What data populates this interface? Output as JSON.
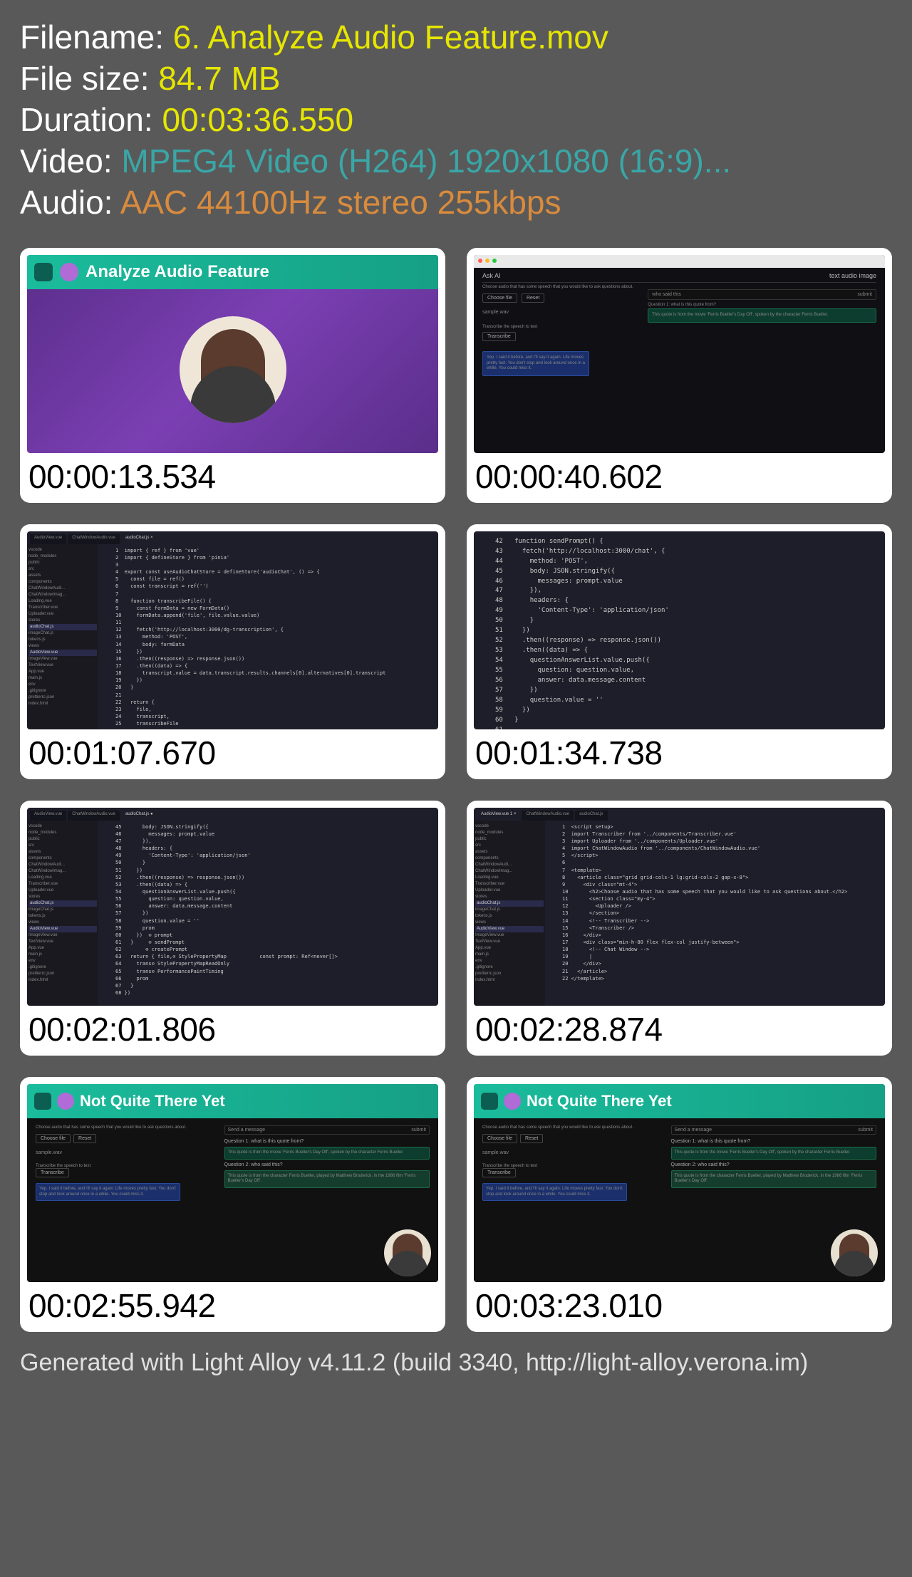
{
  "meta": {
    "filename_label": "Filename: ",
    "filename_value": "6. Analyze Audio Feature.mov",
    "filesize_label": "File size: ",
    "filesize_value": "84.7 MB",
    "duration_label": "Duration: ",
    "duration_value": "00:03:36.550",
    "video_label": "Video: ",
    "video_value": "MPEG4 Video (H264) 1920x1080 (16:9)...",
    "audio_label": "Audio: ",
    "audio_value": "AAC 44100Hz stereo 255kbps"
  },
  "timestamps": [
    "00:00:13.534",
    "00:00:40.602",
    "00:01:07.670",
    "00:01:34.738",
    "00:02:01.806",
    "00:02:28.874",
    "00:02:55.942",
    "00:03:23.010"
  ],
  "thumb1": {
    "title": "Analyze Audio Feature"
  },
  "thumb2": {
    "app_title": "Ask AI",
    "tabs": "text  audio  image",
    "instruction": "Choose audio that has some speech that you would like to ask questions about.",
    "choose": "Choose file",
    "reset": "Reset",
    "file": "sample.wav",
    "input_hint": "who said this",
    "submit": "submit",
    "q1": "Question 1: what is this quote from?",
    "a1": "This quote is from the movie 'Ferris Bueller's Day Off', spoken by the character Ferris Bueller.",
    "trans_label": "Transcribe the speech to text",
    "trans_btn": "Transcribe",
    "trans_text": "Yep. I said it before, and I'll say it again. Life moves pretty fast. You don't stop and look around once in a while. You could miss it."
  },
  "thumb3": {
    "tabs": [
      "AudioView.vue",
      "ChatWindowAudio.vue",
      "audioChat.js ×"
    ],
    "sidebar": [
      "vscode",
      "node_modules",
      "public",
      "src",
      " assets",
      " components",
      "  ChatWindowAudi...",
      "  ChatWindowImag...",
      "  Loading.vue",
      "  Transcriber.vue",
      "  Uploader.vue",
      " stores",
      "  audioChat.js",
      "  imageChat.js",
      "  tokens.js",
      " views",
      "  AudioView.vue",
      "  ImageView.vue",
      "  TextView.vue",
      " App.vue",
      " main.js",
      "env",
      ".gitignore",
      "prettierrc.json",
      "index.html"
    ],
    "code": "1  import { ref } from 'vue'\n2  import { defineStore } from 'pinia'\n3\n4  export const useAudioChatStore = defineStore('audioChat', () => {\n5    const file = ref()\n6    const transcript = ref('')\n7\n8    function transcribeFile() {\n9      const formData = new FormData()\n10     formData.append('file', file.value.value)\n11\n12     fetch('http://localhost:3000/dg-transcription', {\n13       method: 'POST',\n14       body: formData\n15     })\n16     .then((response) => response.json())\n17     .then((data) => {\n18       transcript.value = data.transcript.results.channels[0].alternatives[0].transcript\n19     })\n20   }\n21\n22   return {\n23     file,\n24     transcript,\n25     transcribeFile"
  },
  "thumb4": {
    "code": "42   function sendPrompt() {\n43     fetch('http://localhost:3000/chat', {\n44       method: 'POST',\n45       body: JSON.stringify({\n46         messages: prompt.value\n47       }),\n48       headers: {\n49         'Content-Type': 'application/json'\n50       }\n51     })\n52     .then((response) => response.json())\n53     .then((data) => {\n54       questionAnswerList.value.push({\n55         question: question.value,\n56         answer: data.message.content\n57       })\n58       question.value = ''\n59     })\n60   }\n61"
  },
  "thumb5": {
    "tabs": [
      "AudioView.vue",
      "ChatWindowAudio.vue",
      "audioChat.js ●"
    ],
    "sidebar": [
      "vscode",
      "node_modules",
      "public",
      "src",
      " assets",
      " components",
      "  ChatWindowAudi...",
      "  ChatWindowImag...",
      "  Loading.vue",
      "  Transcriber.vue",
      "  Uploader.vue",
      " stores",
      "  audioChat.js",
      "  imageChat.js",
      "  tokens.js",
      " views",
      "  AudioView.vue",
      "  ImageView.vue",
      "  TextView.vue",
      " App.vue",
      " main.js",
      "env",
      ".gitignore",
      "prettierrc.json",
      "index.html"
    ],
    "code": "45       body: JSON.stringify({\n46         messages: prompt.value\n47       }),\n48       headers: {\n49         'Content-Type': 'application/json'\n50       }\n51     })\n52     .then((response) => response.json())\n53     .then((data) => {\n54       questionAnswerList.value.push({\n55         question: question.value,\n56         answer: data.message.content\n57       })\n58       question.value = ''\n59       prom\n60     })  ⊙ prompt\n61   }     ⊙ sendPrompt\n62        ⊙ createPrompt\n63   return { file,⊙ StylePropertyMap           const prompt: Ref<never[]>\n64     trans⊙ StylePropertyMapReadOnly\n65     trans⊙ PerformancePaintTiming\n66     prom\n67   }\n68 })"
  },
  "thumb6": {
    "tabs": [
      "AudioView.vue 1 ×",
      "ChatWindowAudio.vue",
      "audioChat.js"
    ],
    "sidebar": [
      "vscode",
      "node_modules",
      "public",
      "src",
      " assets",
      " components",
      "  ChatWindowAudi...",
      "  ChatWindowImag...",
      "  Loading.vue",
      "  Transcriber.vue",
      "  Uploader.vue",
      " stores",
      "  audioChat.js",
      "  imageChat.js",
      "  tokens.js",
      " views",
      "  AudioView.vue",
      "  ImageView.vue",
      "  TextView.vue",
      " App.vue",
      " main.js",
      "env",
      ".gitignore",
      "prettierrc.json",
      "index.html"
    ],
    "code": "1  <script setup>\n2  import Transcriber from '../components/Transcriber.vue'\n3  import Uploader from '../components/Uploader.vue'\n4  import ChatWindowAudio from '../components/ChatWindowAudio.vue'\n5  </script>\n6\n7  <template>\n8    <article class=\"grid grid-cols-1 lg:grid-cols-2 gap-x-8\">\n9      <div class=\"mt-4\">\n10       <h2>Choose audio that has some speech that you would like to ask questions about.</h2>\n11       <section class=\"my-4\">\n12         <Uploader />\n13       </section>\n14       <!-- Transcriber -->\n15       <Transcriber />\n16     </div>\n17     <div class=\"min-h-80 flex flex-col justify-between\">\n18       <!-- Chat Window -->\n19       |\n20     </div>\n21   </article>\n22 </template>"
  },
  "thumb7": {
    "title": "Not Quite There Yet",
    "instruction": "Choose audio that has some speech that you would like to ask questions about.",
    "choose": "Choose file",
    "reset": "Reset",
    "file": "sample.wav",
    "trans_label": "Transcribe the speech to text",
    "trans_btn": "Transcribe",
    "trans_text": "Yep. I said it before, and I'll say it again. Life moves pretty fast. You don't stop and look around once in a while. You could miss it.",
    "send": "Send a message",
    "submit": "submit",
    "q1": "Question 1: what is this quote from?",
    "a1": "This quote is from the movie 'Ferris Bueller's Day Off', spoken by the character Ferris Bueller.",
    "q2": "Question 2: who said this?",
    "a2": "This quote is from the character Ferris Bueller, played by Matthew Broderick, in the 1986 film 'Ferris Bueller's Day Off'."
  },
  "thumb8": {
    "title": "Not Quite There Yet",
    "instruction": "Choose audio that has some speech that you would like to ask questions about.",
    "choose": "Choose file",
    "reset": "Reset",
    "file": "sample.wav",
    "trans_label": "Transcribe the speech to text",
    "trans_btn": "Transcribe",
    "trans_text": "Yep. I said it before, and I'll say it again. Life moves pretty fast. You don't stop and look around once in a while. You could miss it.",
    "send": "Send a message",
    "submit": "submit",
    "q1": "Question 1: what is this quote from?",
    "a1": "This quote is from the movie 'Ferris Bueller's Day Off', spoken by the character Ferris Bueller.",
    "q2": "Question 2: who said this?",
    "a2": "This quote is from the character Ferris Bueller, played by Matthew Broderick, in the 1986 film 'Ferris Bueller's Day Off'."
  },
  "footer": "Generated with Light Alloy v4.11.2 (build 3340, http://light-alloy.verona.im)"
}
